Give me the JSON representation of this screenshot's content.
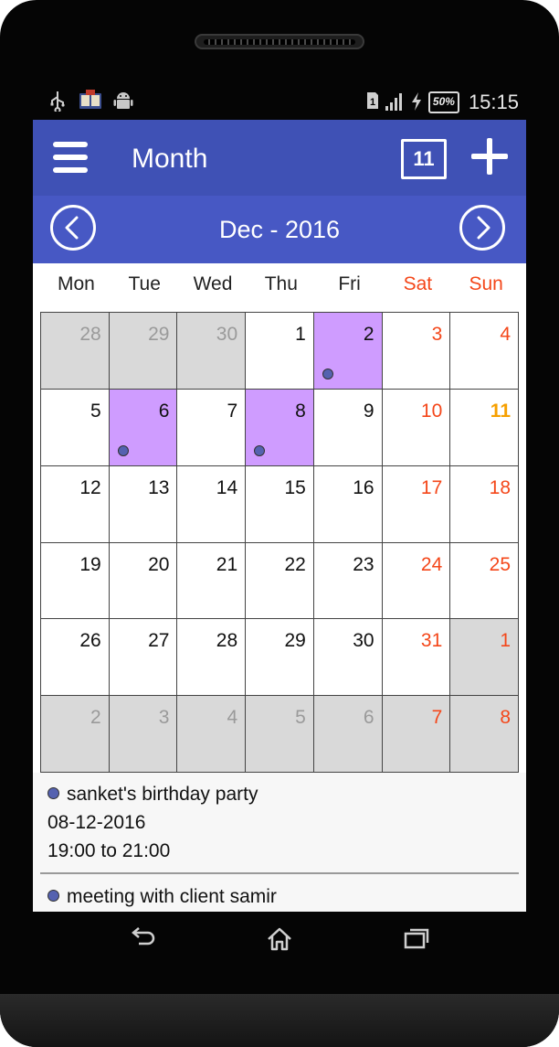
{
  "status_bar": {
    "time": "15:15",
    "battery": "50%",
    "left_icons": [
      "usb-icon",
      "book-icon",
      "android-icon"
    ],
    "right_icons": [
      "sim-icon",
      "signal-icon",
      "charging-icon",
      "battery-icon"
    ]
  },
  "app_bar": {
    "title": "Month",
    "today_badge": "11",
    "menu_icon": "hamburger-menu-icon",
    "add_icon": "plus-icon"
  },
  "month_nav": {
    "label": "Dec - 2016",
    "prev_icon": "chevron-left-icon",
    "next_icon": "chevron-right-icon"
  },
  "weekdays": [
    "Mon",
    "Tue",
    "Wed",
    "Thu",
    "Fri",
    "Sat",
    "Sun"
  ],
  "weeks": [
    [
      {
        "day": "28",
        "other": true
      },
      {
        "day": "29",
        "other": true
      },
      {
        "day": "30",
        "other": true
      },
      {
        "day": "1"
      },
      {
        "day": "2",
        "event": true
      },
      {
        "day": "3"
      },
      {
        "day": "4"
      }
    ],
    [
      {
        "day": "5"
      },
      {
        "day": "6",
        "event": true
      },
      {
        "day": "7"
      },
      {
        "day": "8",
        "event": true
      },
      {
        "day": "9"
      },
      {
        "day": "10"
      },
      {
        "day": "11",
        "today": true
      }
    ],
    [
      {
        "day": "12"
      },
      {
        "day": "13"
      },
      {
        "day": "14"
      },
      {
        "day": "15"
      },
      {
        "day": "16"
      },
      {
        "day": "17"
      },
      {
        "day": "18"
      }
    ],
    [
      {
        "day": "19"
      },
      {
        "day": "20"
      },
      {
        "day": "21"
      },
      {
        "day": "22"
      },
      {
        "day": "23"
      },
      {
        "day": "24"
      },
      {
        "day": "25"
      }
    ],
    [
      {
        "day": "26"
      },
      {
        "day": "27"
      },
      {
        "day": "28"
      },
      {
        "day": "29"
      },
      {
        "day": "30"
      },
      {
        "day": "31"
      },
      {
        "day": "1",
        "other": true
      }
    ],
    [
      {
        "day": "2",
        "other": true
      },
      {
        "day": "3",
        "other": true
      },
      {
        "day": "4",
        "other": true
      },
      {
        "day": "5",
        "other": true
      },
      {
        "day": "6",
        "other": true
      },
      {
        "day": "7",
        "other": true
      },
      {
        "day": "8",
        "other": true
      }
    ]
  ],
  "events": [
    {
      "title": "sanket's birthday party",
      "date": "08-12-2016",
      "time": "19:00 to 21:00"
    },
    {
      "title": "meeting with client samir"
    }
  ],
  "colors": {
    "primary": "#3f51b5",
    "nav_bar": "#4758c4",
    "event_cell": "#cf9cff",
    "other_month_cell": "#d9d9d9",
    "weekend_text": "#f4471a",
    "today_text": "#f6a000",
    "event_dot": "#5562b0"
  },
  "system_nav": {
    "back_icon": "back-icon",
    "home_icon": "home-icon",
    "recents_icon": "recent-apps-icon"
  }
}
